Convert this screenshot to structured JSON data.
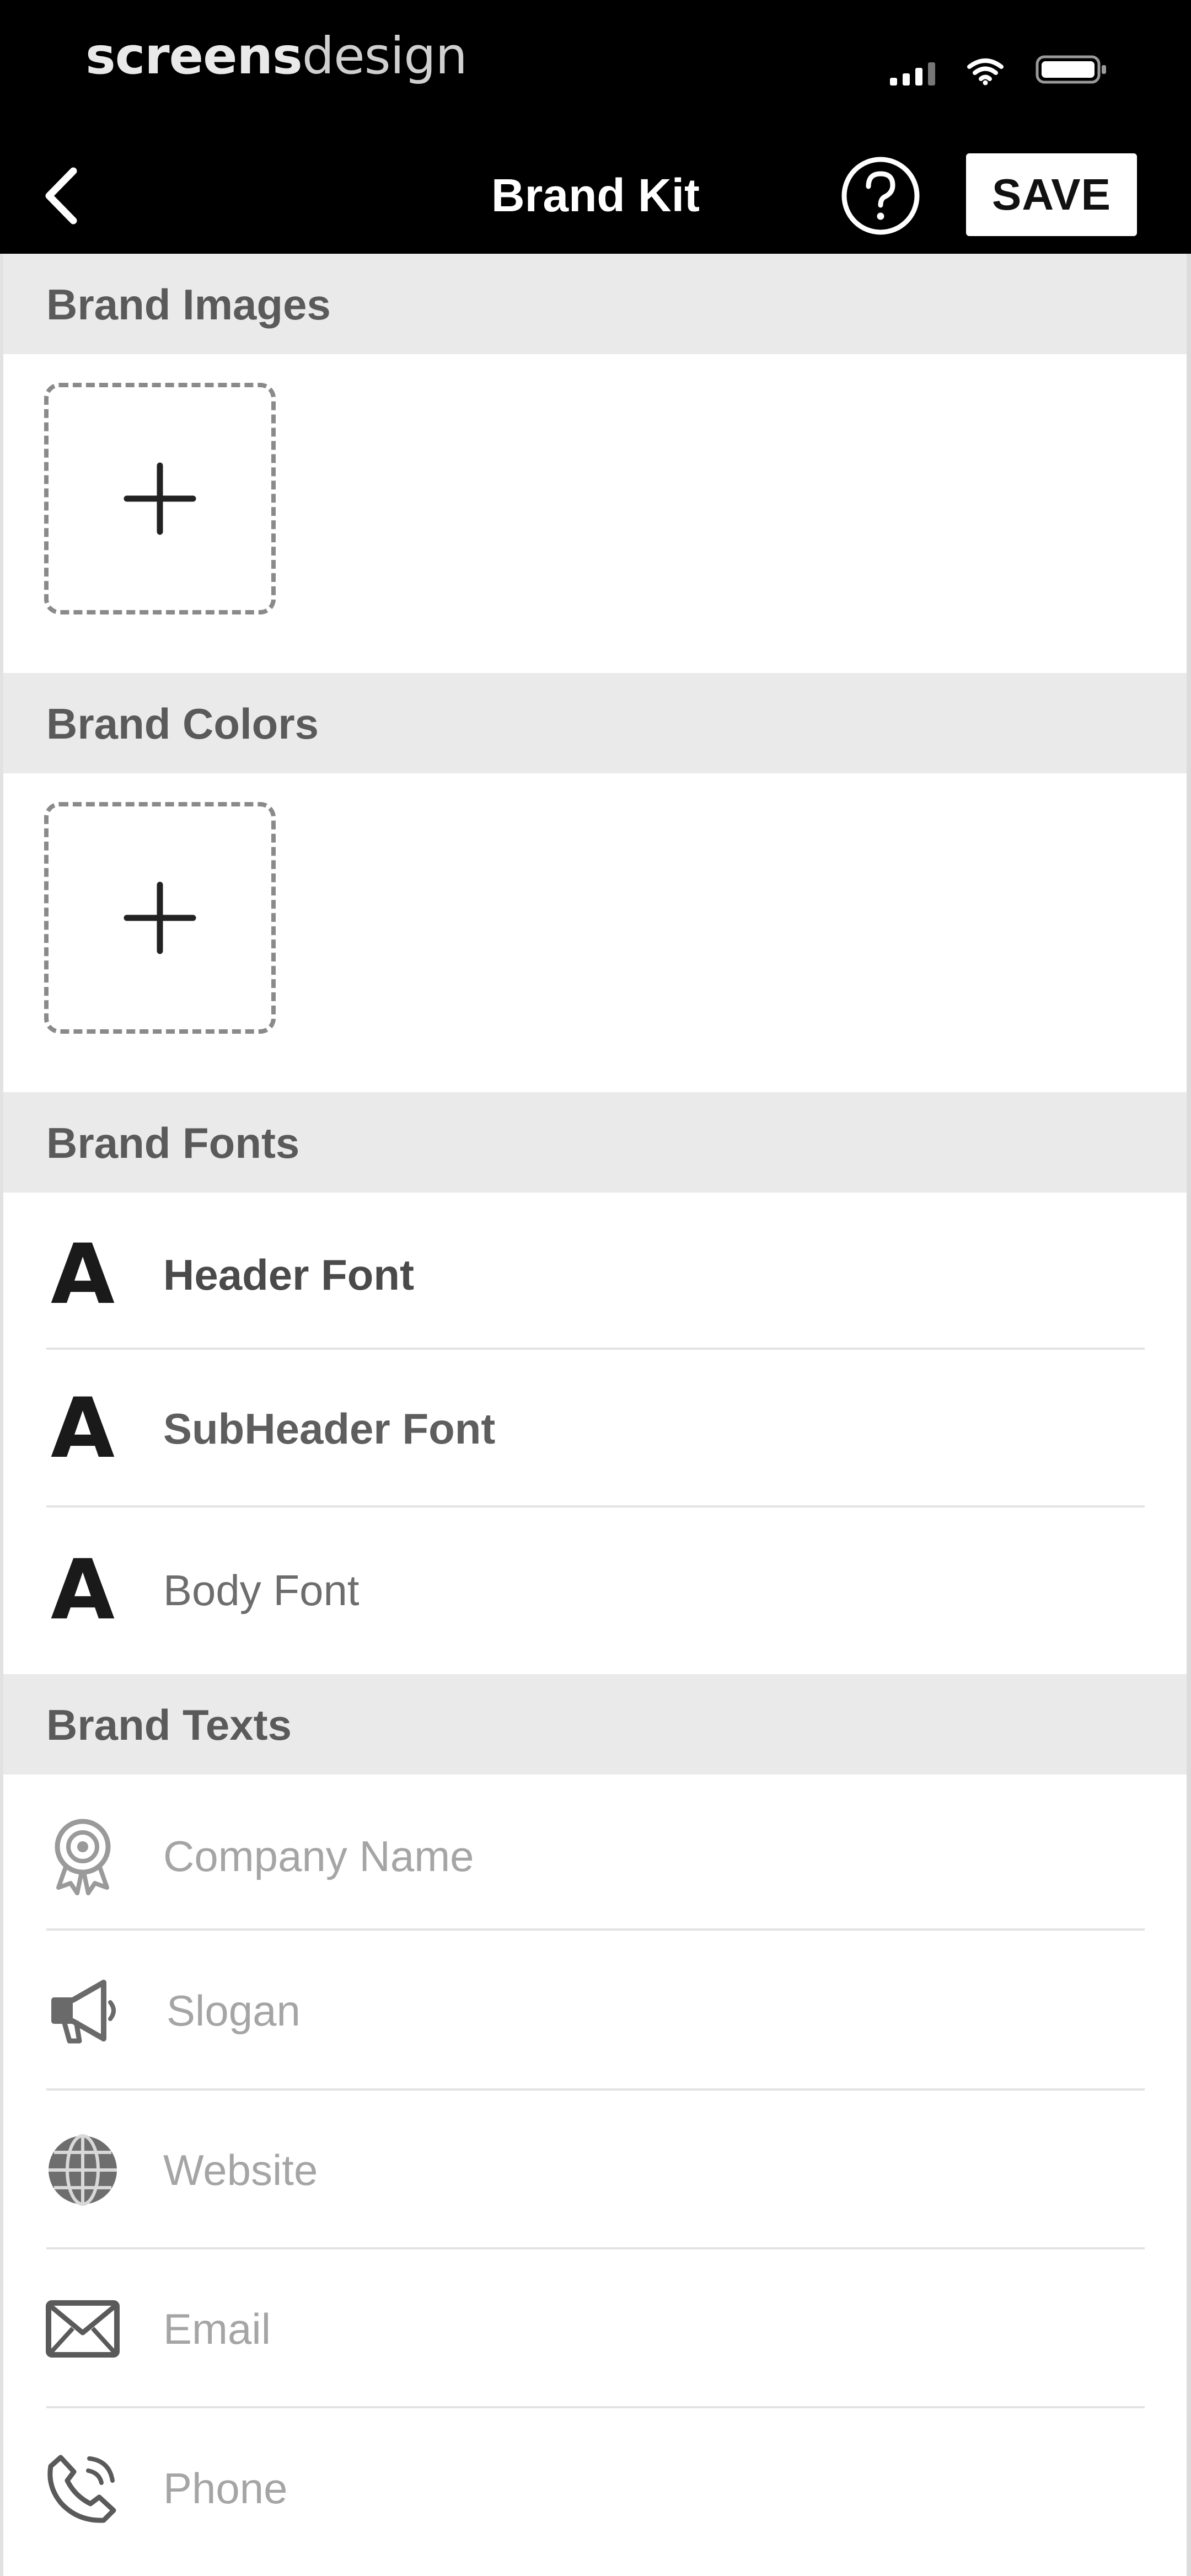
{
  "status_bar": {
    "watermark_bold": "screens",
    "watermark_light": "design",
    "icons": [
      "signal-icon",
      "wifi-icon",
      "battery-icon"
    ]
  },
  "nav": {
    "back_icon": "chevron-left-icon",
    "title": "Brand Kit",
    "help_icon": "help-circle-icon",
    "save_label": "SAVE"
  },
  "sections": {
    "images": {
      "title": "Brand Images",
      "add_icon": "plus-icon"
    },
    "colors": {
      "title": "Brand Colors",
      "add_icon": "plus-icon"
    },
    "fonts": {
      "title": "Brand Fonts",
      "items": [
        {
          "glyph": "A",
          "label": "Header Font",
          "icon": "font-letter-icon"
        },
        {
          "glyph": "A",
          "label": "SubHeader Font",
          "icon": "font-letter-icon"
        },
        {
          "glyph": "A",
          "label": "Body Font",
          "icon": "font-letter-icon"
        }
      ]
    },
    "texts": {
      "title": "Brand Texts",
      "items": [
        {
          "placeholder": "Company Name",
          "icon": "award-badge-icon"
        },
        {
          "placeholder": "Slogan",
          "icon": "megaphone-icon"
        },
        {
          "placeholder": "Website",
          "icon": "globe-icon"
        },
        {
          "placeholder": "Email",
          "icon": "envelope-icon"
        },
        {
          "placeholder": "Phone",
          "icon": "phone-icon"
        }
      ]
    }
  },
  "colors": {
    "bar_background": "#000000",
    "section_header_background": "#eaeaea",
    "section_title": "#5a5a5a",
    "placeholder_text": "#a5a5a5",
    "tile_border": "#8a8a8a"
  }
}
